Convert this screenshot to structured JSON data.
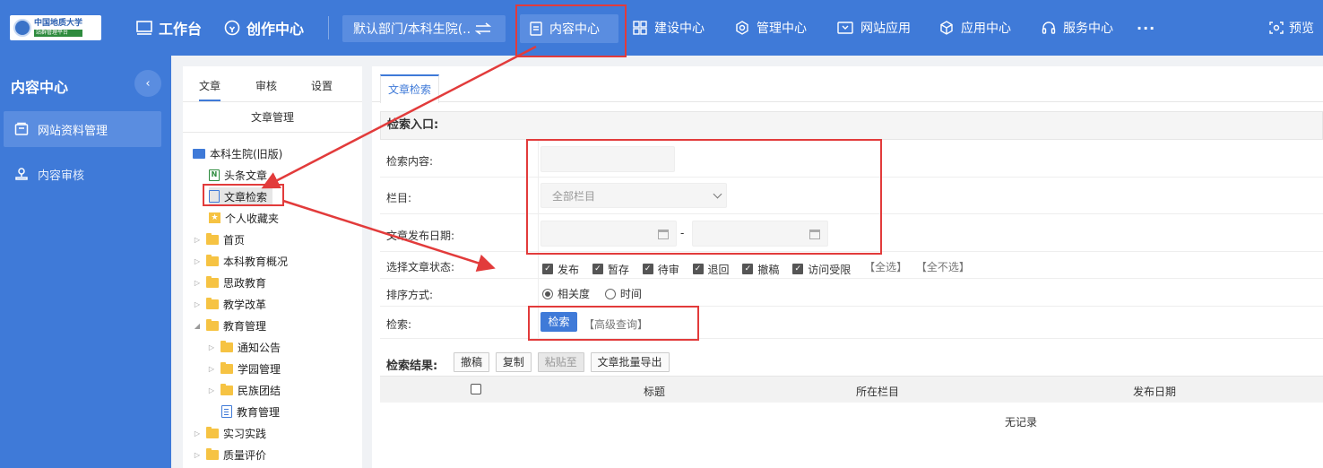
{
  "logo": {
    "title": "中国地质大学",
    "subtitle": "站群管理平台"
  },
  "top": {
    "workbench": "工作台",
    "creation": "创作中心",
    "dept": "默认部门/本科生院(...",
    "menus": [
      "内容中心",
      "建设中心",
      "管理中心",
      "网站应用",
      "应用中心",
      "服务中心"
    ],
    "more": "···",
    "preview": "预览"
  },
  "sidebar": {
    "title": "内容中心",
    "items": [
      "网站资料管理",
      "内容审核"
    ]
  },
  "tree": {
    "tabs": [
      "文章",
      "审核",
      "设置"
    ],
    "header": "文章管理",
    "nodes": [
      "本科生院(旧版)",
      "头条文章",
      "文章检索",
      "个人收藏夹",
      "首页",
      "本科教育概况",
      "思政教育",
      "教学改革",
      "教育管理",
      "通知公告",
      "学园管理",
      "民族团结",
      "教育管理",
      "实习实践",
      "质量评价"
    ]
  },
  "content": {
    "tab": "文章检索",
    "section": "检索入口:",
    "labels": {
      "keyword": "检索内容:",
      "column": "栏目:",
      "date": "文章发布日期:",
      "status": "选择文章状态:",
      "sort": "排序方式:",
      "search": "检索:"
    },
    "column_value": "全部栏目",
    "date_sep": "-",
    "statuses": [
      "发布",
      "暂存",
      "待审",
      "退回",
      "撤稿",
      "访问受限"
    ],
    "select_all": "【全选】",
    "select_none": "【全不选】",
    "sort_options": [
      "相关度",
      "时间"
    ],
    "search_btn": "检索",
    "advanced": "【高级查询】",
    "results_label": "检索结果:",
    "result_btns": [
      "撤稿",
      "复制",
      "粘贴至",
      "文章批量导出"
    ],
    "columns": [
      "标题",
      "所在栏目",
      "发布日期"
    ],
    "empty": "无记录"
  },
  "colors": {
    "primary": "#3f7ad8",
    "highlight": "#e23b3b"
  }
}
